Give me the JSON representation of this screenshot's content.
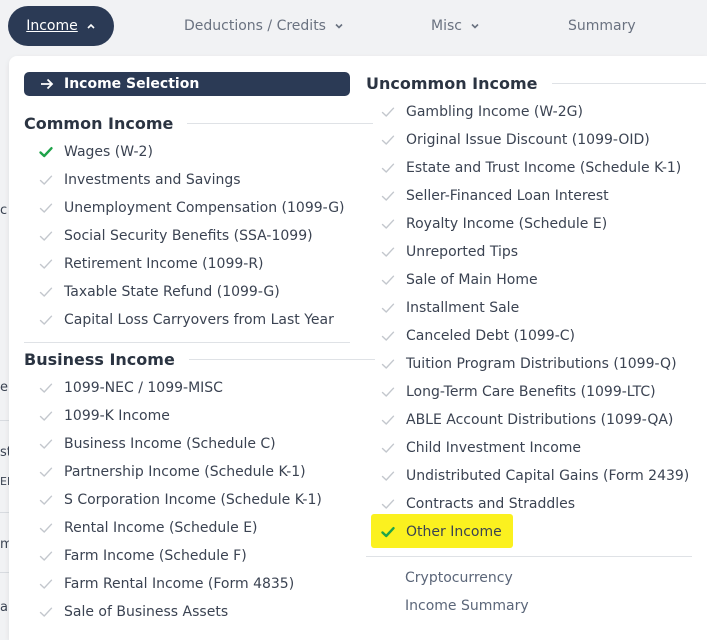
{
  "nav": {
    "income": "Income",
    "deductions": "Deductions / Credits",
    "misc": "Misc",
    "summary": "Summary"
  },
  "edge_fragments": [
    "c",
    "e",
    "st",
    "EN",
    "m",
    "al"
  ],
  "selection_bar": "Income Selection",
  "common": {
    "title": "Common Income",
    "items": [
      {
        "label": "Wages (W-2)",
        "checked": true
      },
      {
        "label": "Investments and Savings",
        "checked": false
      },
      {
        "label": "Unemployment Compensation (1099-G)",
        "checked": false
      },
      {
        "label": "Social Security Benefits (SSA-1099)",
        "checked": false
      },
      {
        "label": "Retirement Income (1099-R)",
        "checked": false
      },
      {
        "label": "Taxable State Refund (1099-G)",
        "checked": false
      },
      {
        "label": "Capital Loss Carryovers from Last Year",
        "checked": false
      }
    ]
  },
  "business": {
    "title": "Business Income",
    "items": [
      {
        "label": "1099-NEC / 1099-MISC",
        "checked": false
      },
      {
        "label": "1099-K Income",
        "checked": false
      },
      {
        "label": "Business Income (Schedule C)",
        "checked": false
      },
      {
        "label": "Partnership Income (Schedule K-1)",
        "checked": false
      },
      {
        "label": "S Corporation Income (Schedule K-1)",
        "checked": false
      },
      {
        "label": "Rental Income (Schedule E)",
        "checked": false
      },
      {
        "label": "Farm Income (Schedule F)",
        "checked": false
      },
      {
        "label": "Farm Rental Income (Form 4835)",
        "checked": false
      },
      {
        "label": "Sale of Business Assets",
        "checked": false
      }
    ]
  },
  "uncommon": {
    "title": "Uncommon Income",
    "items": [
      {
        "label": "Gambling Income (W-2G)",
        "checked": false
      },
      {
        "label": "Original Issue Discount (1099-OID)",
        "checked": false
      },
      {
        "label": "Estate and Trust Income (Schedule K-1)",
        "checked": false
      },
      {
        "label": "Seller-Financed Loan Interest",
        "checked": false
      },
      {
        "label": "Royalty Income (Schedule E)",
        "checked": false
      },
      {
        "label": "Unreported Tips",
        "checked": false
      },
      {
        "label": "Sale of Main Home",
        "checked": false
      },
      {
        "label": "Installment Sale",
        "checked": false
      },
      {
        "label": "Canceled Debt (1099-C)",
        "checked": false
      },
      {
        "label": "Tuition Program Distributions (1099-Q)",
        "checked": false
      },
      {
        "label": "Long-Term Care Benefits (1099-LTC)",
        "checked": false
      },
      {
        "label": "ABLE Account Distributions (1099-QA)",
        "checked": false
      },
      {
        "label": "Child Investment Income",
        "checked": false
      },
      {
        "label": "Undistributed Capital Gains (Form 2439)",
        "checked": false
      },
      {
        "label": "Contracts and Straddles",
        "checked": false
      },
      {
        "label": "Other Income",
        "checked": true
      }
    ]
  },
  "links": {
    "crypto": "Cryptocurrency",
    "summary": "Income Summary"
  },
  "colors": {
    "nav_active_bg": "#2b3a55",
    "check_active": "#1fa34a",
    "check_inactive": "#c3c7cd",
    "highlight": "#fbf11f"
  }
}
